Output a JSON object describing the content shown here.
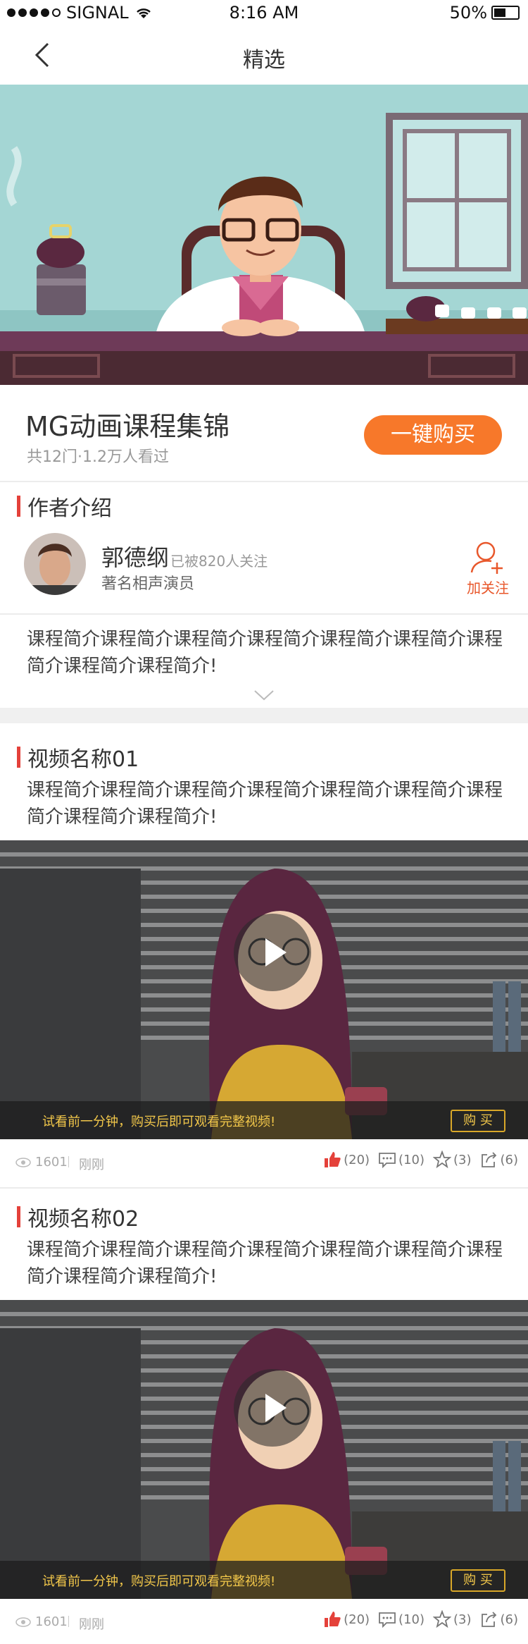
{
  "status_bar": {
    "carrier": "SIGNAL",
    "time": "8:16 AM",
    "battery": "50%"
  },
  "nav": {
    "title": "精选"
  },
  "course": {
    "title": "MG动画课程集锦",
    "meta": "共12门·1.2万人看过",
    "buy_label": "一键购买"
  },
  "author_section": {
    "heading": "作者介绍",
    "name": "郭德纲",
    "followers": "已被820人关注",
    "role": "著名相声演员",
    "follow_label": "加关注",
    "intro": "课程简介课程简介课程简介课程简介课程简介课程简介课程简介课程简介课程简介!"
  },
  "videos": [
    {
      "title": "视频名称01",
      "desc": "课程简介课程简介课程简介课程简介课程简介课程简介课程简介课程简介课程简介!",
      "trial_hint": "试看前一分钟，购买后即可观看完整视频!",
      "buy_label": "购 买",
      "views": "1601",
      "time": "刚刚",
      "likes": "(20)",
      "comments": "(10)",
      "stars": "(3)",
      "shares": "(6)"
    },
    {
      "title": "视频名称02",
      "desc": "课程简介课程简介课程简介课程简介课程简介课程简介课程简介课程简介课程简介!",
      "trial_hint": "试看前一分钟，购买后即可观看完整视频!",
      "buy_label": "购 买",
      "views": "1601",
      "time": "刚刚",
      "likes": "(20)",
      "comments": "(10)",
      "stars": "(3)",
      "shares": "(6)"
    }
  ],
  "colors": {
    "accent": "#f7782a",
    "section_bar": "#e4413a",
    "like": "#e4413a",
    "trial_text": "#f3c84a"
  }
}
